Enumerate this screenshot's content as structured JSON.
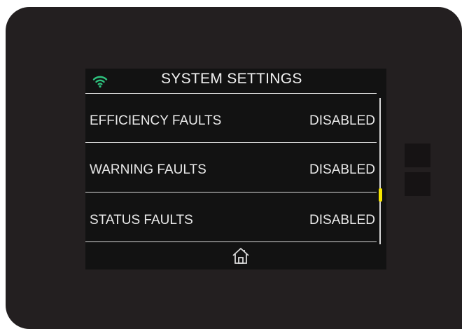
{
  "screen": {
    "title": "SYSTEM SETTINGS",
    "rows": [
      {
        "label": "EFFICIENCY FAULTS",
        "value": "DISABLED"
      },
      {
        "label": "WARNING FAULTS",
        "value": "DISABLED"
      },
      {
        "label": "STATUS FAULTS",
        "value": "DISABLED"
      }
    ],
    "icons": {
      "status": "wifi-icon",
      "nav": "home-icon"
    },
    "scroll_position": 0.68
  },
  "colors": {
    "wifi": "#2ec27e",
    "scroll_thumb": "#f7e600",
    "text": "#eaeaea",
    "bezel": "#231f20"
  }
}
